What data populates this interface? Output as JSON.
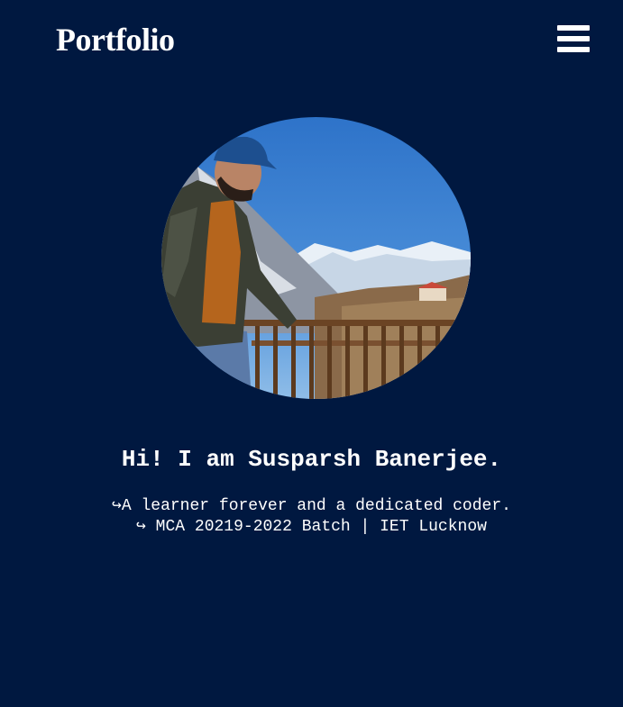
{
  "navbar": {
    "brand": "Portfolio",
    "menu_icon": "hamburger-menu-icon"
  },
  "hero": {
    "photo_alt": "Profile photo",
    "greeting": "Hi! I am Susparsh Banerjee.",
    "tagline_line1": "↪A learner forever and a dedicated coder.",
    "tagline_line2": "↪ MCA 20219-2022 Batch | IET Lucknow"
  },
  "colors": {
    "background": "#001840",
    "text": "#ffffff"
  }
}
